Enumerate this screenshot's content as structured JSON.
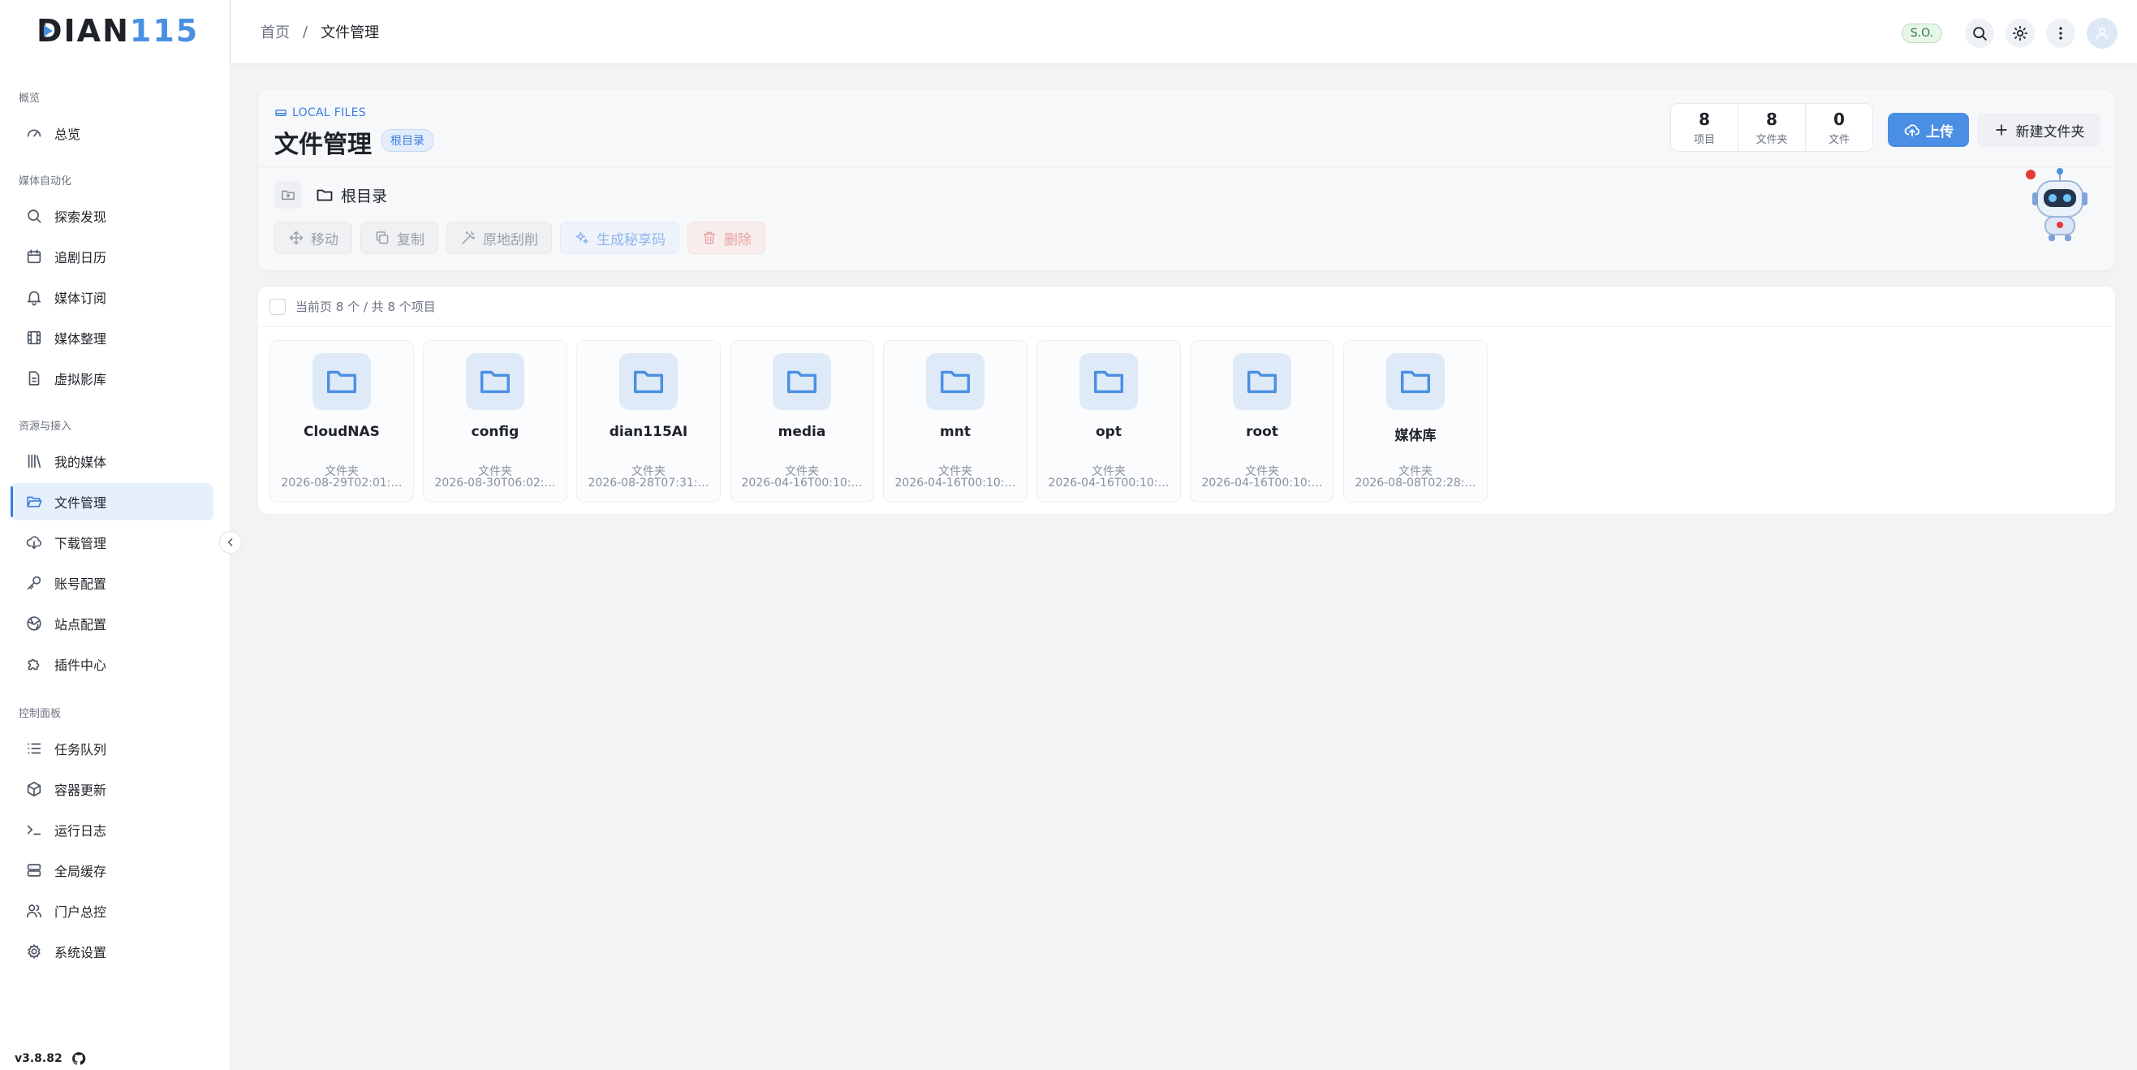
{
  "brand": {
    "logo_d": "D",
    "logo_ian": "IAN",
    "logo_num": "115",
    "accent": "#4a90e2"
  },
  "sidebar": {
    "sections": [
      "概览",
      "媒体自动化",
      "资源与接入",
      "控制面板"
    ],
    "items": [
      {
        "label": "总览",
        "icon": "gauge-icon"
      },
      {
        "label": "探索发现",
        "icon": "search-icon"
      },
      {
        "label": "追剧日历",
        "icon": "calendar-icon"
      },
      {
        "label": "媒体订阅",
        "icon": "bell-icon"
      },
      {
        "label": "媒体整理",
        "icon": "film-icon"
      },
      {
        "label": "虚拟影库",
        "icon": "file-icon"
      },
      {
        "label": "我的媒体",
        "icon": "library-icon"
      },
      {
        "label": "文件管理",
        "icon": "folder-open-icon",
        "active": true
      },
      {
        "label": "下载管理",
        "icon": "cloud-download-icon"
      },
      {
        "label": "账号配置",
        "icon": "key-icon"
      },
      {
        "label": "站点配置",
        "icon": "globe-icon"
      },
      {
        "label": "插件中心",
        "icon": "puzzle-icon"
      },
      {
        "label": "任务队列",
        "icon": "list-icon"
      },
      {
        "label": "容器更新",
        "icon": "box-icon"
      },
      {
        "label": "运行日志",
        "icon": "terminal-icon"
      },
      {
        "label": "全局缓存",
        "icon": "server-icon"
      },
      {
        "label": "门户总控",
        "icon": "users-icon"
      },
      {
        "label": "系统设置",
        "icon": "gear-icon"
      }
    ],
    "version": "v3.8.82"
  },
  "topbar": {
    "breadcrumb": [
      "首页",
      "/",
      "文件管理"
    ],
    "status_badge": "S.O."
  },
  "header": {
    "overline": "LOCAL FILES",
    "title": "文件管理",
    "root_badge": "根目录",
    "stats": [
      {
        "value": "8",
        "label": "项目"
      },
      {
        "value": "8",
        "label": "文件夹"
      },
      {
        "value": "0",
        "label": "文件"
      }
    ],
    "upload_label": "上传",
    "new_folder_label": "新建文件夹",
    "path_label": "根目录",
    "actions": [
      {
        "label": "移动",
        "icon": "move-icon",
        "style": "gray"
      },
      {
        "label": "复制",
        "icon": "copy-icon",
        "style": "gray"
      },
      {
        "label": "原地刮削",
        "icon": "wand-icon",
        "style": "gray"
      },
      {
        "label": "生成秘享码",
        "icon": "sparkles-icon",
        "style": "blue"
      },
      {
        "label": "删除",
        "icon": "trash-icon",
        "style": "red"
      }
    ]
  },
  "files": {
    "summary": "当前页 8 个 / 共 8 个项目",
    "items": [
      {
        "name": "CloudNAS",
        "type": "文件夹",
        "time": "2026-08-29T02:01:…"
      },
      {
        "name": "config",
        "type": "文件夹",
        "time": "2026-08-30T06:02:…"
      },
      {
        "name": "dian115AI",
        "type": "文件夹",
        "time": "2026-08-28T07:31:…"
      },
      {
        "name": "media",
        "type": "文件夹",
        "time": "2026-04-16T00:10:…"
      },
      {
        "name": "mnt",
        "type": "文件夹",
        "time": "2026-04-16T00:10:…"
      },
      {
        "name": "opt",
        "type": "文件夹",
        "time": "2026-04-16T00:10:…"
      },
      {
        "name": "root",
        "type": "文件夹",
        "time": "2026-04-16T00:10:…"
      },
      {
        "name": "媒体库",
        "type": "文件夹",
        "time": "2026-08-08T02:28:…"
      }
    ]
  }
}
